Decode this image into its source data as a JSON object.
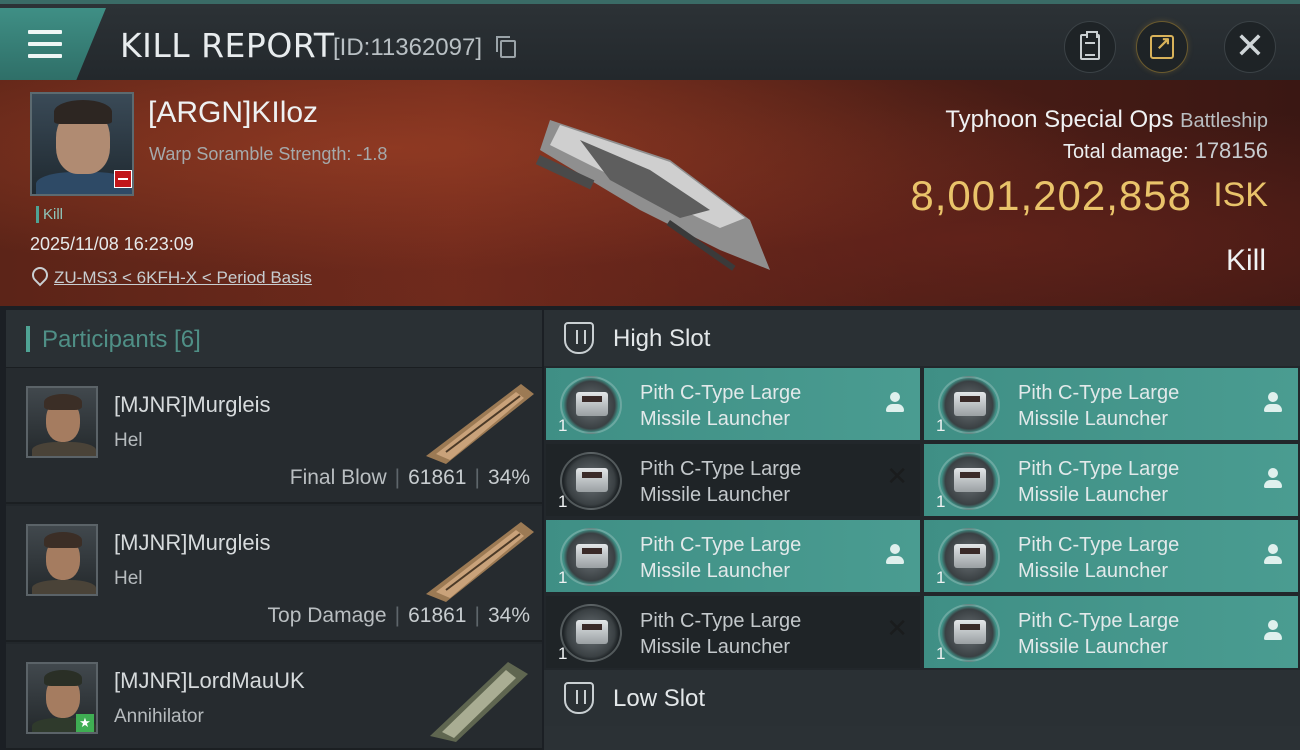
{
  "header": {
    "title": "KILL REPORT",
    "report_id": "[ID:11362097]"
  },
  "victim": {
    "name": "[ARGN]KIloz",
    "warp_scramble": "Warp Soramble Strength: -1.8",
    "tag": "Kill",
    "datetime": "2025/11/08 16:23:09",
    "location": "ZU-MS3 < 6KFH-X < Period Basis"
  },
  "ship": {
    "name": "Typhoon Special Ops",
    "class": "Battleship",
    "total_damage_label": "Total damage:",
    "total_damage": "178156",
    "isk_value": "8,001,202,858",
    "isk_unit": "ISK",
    "result": "Kill"
  },
  "participants": {
    "label": "Participants [6]",
    "items": [
      {
        "name": "[MJNR]Murgleis",
        "ship": "Hel",
        "role": "Final Blow",
        "damage": "61861",
        "percent": "34%"
      },
      {
        "name": "[MJNR]Murgleis",
        "ship": "Hel",
        "role": "Top Damage",
        "damage": "61861",
        "percent": "34%"
      },
      {
        "name": "[MJNR]LordMauUK",
        "ship": "Annihilator"
      }
    ]
  },
  "slots": {
    "high_label": "High Slot",
    "low_label": "Low Slot",
    "modules": [
      {
        "line1": "Pith C-Type Large",
        "line2": "Missile Launcher",
        "qty": "1",
        "status": "dropped"
      },
      {
        "line1": "Pith C-Type Large",
        "line2": "Missile Launcher",
        "qty": "1",
        "status": "dropped"
      },
      {
        "line1": "Pith C-Type Large",
        "line2": "Missile Launcher",
        "qty": "1",
        "status": "destroyed"
      },
      {
        "line1": "Pith C-Type Large",
        "line2": "Missile Launcher",
        "qty": "1",
        "status": "dropped"
      },
      {
        "line1": "Pith C-Type Large",
        "line2": "Missile Launcher",
        "qty": "1",
        "status": "dropped"
      },
      {
        "line1": "Pith C-Type Large",
        "line2": "Missile Launcher",
        "qty": "1",
        "status": "dropped"
      },
      {
        "line1": "Pith C-Type Large",
        "line2": "Missile Launcher",
        "qty": "1",
        "status": "destroyed"
      },
      {
        "line1": "Pith C-Type Large",
        "line2": "Missile Launcher",
        "qty": "1",
        "status": "dropped"
      }
    ]
  },
  "colors": {
    "accent": "#4a9c91",
    "isk_gold": "#e9c36a",
    "banner_red": "#6e2a1c"
  },
  "icons": [
    "menu-icon",
    "copy-icon",
    "clipboard-icon",
    "share-icon",
    "close-icon",
    "location-pin-icon",
    "high-slot-icon",
    "low-slot-icon",
    "person-icon",
    "x-icon",
    "module-icon"
  ]
}
